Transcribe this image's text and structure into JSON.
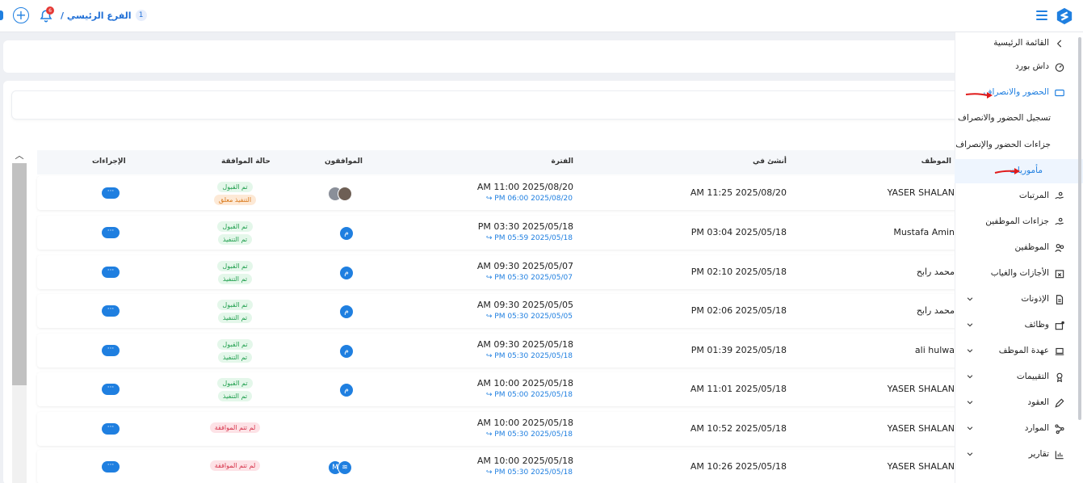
{
  "header": {
    "branch_number": "1",
    "branch_name": "الفرع الرئيسي /",
    "notification_count": "6"
  },
  "colors": {
    "accent": "#1f7fe0",
    "success": "#1e9e4c",
    "warning": "#d9791b",
    "danger": "#d6334a"
  },
  "table": {
    "columns": {
      "employee": "الموظف",
      "created_at": "أنشئ في",
      "period": "الفترة",
      "approvers": "الموافقون",
      "approval_status": "حالة الموافقة",
      "actions": "الإجراءات"
    },
    "rows": [
      {
        "employee": "YASER SHALAN",
        "created": "AM 11:25 2025/08/20",
        "period_start": "AM 11:00 2025/08/20",
        "period_end": "PM 06:00 2025/08/20 ↪",
        "approvers": [
          "photo",
          "photo2"
        ],
        "status": [
          "تم القبول",
          "التنفيذ معلق"
        ],
        "status_colors": [
          "green",
          "orange"
        ],
        "actions": "···"
      },
      {
        "employee": "Mustafa Amin",
        "created": "PM 03:04 2025/05/18",
        "period_start": "PM 03:30 2025/05/18",
        "period_end": "PM 05:59 2025/05/18 ↪",
        "approvers": [
          "م"
        ],
        "status": [
          "تم القبول",
          "تم التنفيذ"
        ],
        "status_colors": [
          "green",
          "green"
        ],
        "actions": "···"
      },
      {
        "employee": "محمد رابح",
        "created": "PM 02:10 2025/05/18",
        "period_start": "AM 09:30 2025/05/07",
        "period_end": "PM 05:30 2025/05/07 ↪",
        "approvers": [
          "م"
        ],
        "status": [
          "تم القبول",
          "تم التنفيذ"
        ],
        "status_colors": [
          "green",
          "green"
        ],
        "actions": "···"
      },
      {
        "employee": "محمد رابح",
        "created": "PM 02:06 2025/05/18",
        "period_start": "AM 09:30 2025/05/05",
        "period_end": "PM 05:30 2025/05/05 ↪",
        "approvers": [
          "م"
        ],
        "status": [
          "تم القبول",
          "تم التنفيذ"
        ],
        "status_colors": [
          "green",
          "green"
        ],
        "actions": "···"
      },
      {
        "employee": "ali hulwa",
        "created": "PM 01:39 2025/05/18",
        "period_start": "AM 09:30 2025/05/18",
        "period_end": "PM 05:30 2025/05/18 ↪",
        "approvers": [
          "م"
        ],
        "status": [
          "تم القبول",
          "تم التنفيذ"
        ],
        "status_colors": [
          "green",
          "green"
        ],
        "actions": "···"
      },
      {
        "employee": "YASER SHALAN",
        "created": "AM 11:01 2025/05/18",
        "period_start": "AM 10:00 2025/05/18",
        "period_end": "PM 05:00 2025/05/18 ↪",
        "approvers": [
          "م"
        ],
        "status": [
          "تم القبول",
          "تم التنفيذ"
        ],
        "status_colors": [
          "green",
          "green"
        ],
        "actions": "···"
      },
      {
        "employee": "YASER SHALAN",
        "created": "AM 10:52 2025/05/18",
        "period_start": "AM 10:00 2025/05/18",
        "period_end": "PM 05:30 2025/05/18 ↪",
        "approvers": [],
        "status": [
          "لم تتم الموافقة"
        ],
        "status_colors": [
          "red"
        ],
        "actions": "···"
      },
      {
        "employee": "YASER SHALAN",
        "created": "AM 10:26 2025/05/18",
        "period_start": "AM 10:00 2025/05/18",
        "period_end": "PM 05:30 2025/05/18 ↪",
        "approvers": [
          "M",
          "logo"
        ],
        "status": [
          "لم تتم الموافقة"
        ],
        "status_colors": [
          "red"
        ],
        "actions": "···"
      }
    ]
  },
  "sidebar": {
    "items": [
      {
        "label": "القائمة الرئيسية",
        "icon": "chevron-left-icon"
      },
      {
        "label": "داش بورد",
        "icon": "gauge-icon"
      },
      {
        "label": "الحضور والانصراف",
        "icon": "ticket-icon",
        "active": false,
        "blue": true
      },
      {
        "label": "تسجيل الحضور والانصراف",
        "icon": ""
      },
      {
        "label": "جزاءات الحضور والإنصراف",
        "icon": ""
      },
      {
        "label": "مأموريات",
        "icon": "",
        "active": true,
        "blue": true
      },
      {
        "label": "المرتبات",
        "icon": "money-hand-icon"
      },
      {
        "label": "جزاءات الموظفين",
        "icon": "money-hand-icon"
      },
      {
        "label": "الموظفين",
        "icon": "users-icon"
      },
      {
        "label": "الأجازات والغياب",
        "icon": "calendar-x-icon"
      },
      {
        "label": "الإذونات",
        "icon": "document-icon",
        "expand": true
      },
      {
        "label": "وظائف",
        "icon": "briefcase-icon",
        "expand": true
      },
      {
        "label": "عهدة الموظف",
        "icon": "laptop-icon",
        "expand": true
      },
      {
        "label": "التقييمات",
        "icon": "badge-icon",
        "expand": true
      },
      {
        "label": "العقود",
        "icon": "pen-icon",
        "expand": true
      },
      {
        "label": "الموارد",
        "icon": "share-icon",
        "expand": true
      },
      {
        "label": "تقارير",
        "icon": "chart-icon",
        "expand": true
      }
    ]
  }
}
